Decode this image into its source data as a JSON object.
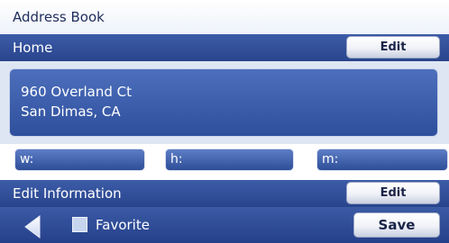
{
  "header": {
    "title": "Address Book"
  },
  "entry": {
    "name": "Home",
    "edit_label": "Edit",
    "address_line1": "960 Overland Ct",
    "address_line2": "San Dimas, CA"
  },
  "phones": {
    "work_label": "w:",
    "home_label": "h:",
    "mobile_label": "m:"
  },
  "info": {
    "label": "Edit Information",
    "edit_label": "Edit"
  },
  "footer": {
    "back_icon": "left-arrow-icon",
    "favorite_label": "Favorite",
    "favorite_checked": false,
    "save_label": "Save"
  }
}
